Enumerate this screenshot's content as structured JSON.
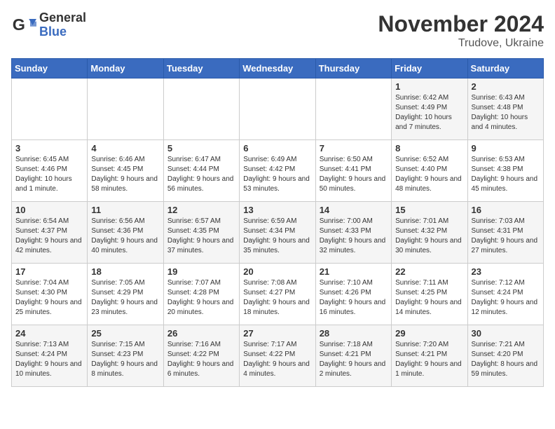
{
  "logo": {
    "general": "General",
    "blue": "Blue"
  },
  "title": "November 2024",
  "location": "Trudove, Ukraine",
  "days_of_week": [
    "Sunday",
    "Monday",
    "Tuesday",
    "Wednesday",
    "Thursday",
    "Friday",
    "Saturday"
  ],
  "weeks": [
    [
      {
        "day": "",
        "info": ""
      },
      {
        "day": "",
        "info": ""
      },
      {
        "day": "",
        "info": ""
      },
      {
        "day": "",
        "info": ""
      },
      {
        "day": "",
        "info": ""
      },
      {
        "day": "1",
        "info": "Sunrise: 6:42 AM\nSunset: 4:49 PM\nDaylight: 10 hours and 7 minutes."
      },
      {
        "day": "2",
        "info": "Sunrise: 6:43 AM\nSunset: 4:48 PM\nDaylight: 10 hours and 4 minutes."
      }
    ],
    [
      {
        "day": "3",
        "info": "Sunrise: 6:45 AM\nSunset: 4:46 PM\nDaylight: 10 hours and 1 minute."
      },
      {
        "day": "4",
        "info": "Sunrise: 6:46 AM\nSunset: 4:45 PM\nDaylight: 9 hours and 58 minutes."
      },
      {
        "day": "5",
        "info": "Sunrise: 6:47 AM\nSunset: 4:44 PM\nDaylight: 9 hours and 56 minutes."
      },
      {
        "day": "6",
        "info": "Sunrise: 6:49 AM\nSunset: 4:42 PM\nDaylight: 9 hours and 53 minutes."
      },
      {
        "day": "7",
        "info": "Sunrise: 6:50 AM\nSunset: 4:41 PM\nDaylight: 9 hours and 50 minutes."
      },
      {
        "day": "8",
        "info": "Sunrise: 6:52 AM\nSunset: 4:40 PM\nDaylight: 9 hours and 48 minutes."
      },
      {
        "day": "9",
        "info": "Sunrise: 6:53 AM\nSunset: 4:38 PM\nDaylight: 9 hours and 45 minutes."
      }
    ],
    [
      {
        "day": "10",
        "info": "Sunrise: 6:54 AM\nSunset: 4:37 PM\nDaylight: 9 hours and 42 minutes."
      },
      {
        "day": "11",
        "info": "Sunrise: 6:56 AM\nSunset: 4:36 PM\nDaylight: 9 hours and 40 minutes."
      },
      {
        "day": "12",
        "info": "Sunrise: 6:57 AM\nSunset: 4:35 PM\nDaylight: 9 hours and 37 minutes."
      },
      {
        "day": "13",
        "info": "Sunrise: 6:59 AM\nSunset: 4:34 PM\nDaylight: 9 hours and 35 minutes."
      },
      {
        "day": "14",
        "info": "Sunrise: 7:00 AM\nSunset: 4:33 PM\nDaylight: 9 hours and 32 minutes."
      },
      {
        "day": "15",
        "info": "Sunrise: 7:01 AM\nSunset: 4:32 PM\nDaylight: 9 hours and 30 minutes."
      },
      {
        "day": "16",
        "info": "Sunrise: 7:03 AM\nSunset: 4:31 PM\nDaylight: 9 hours and 27 minutes."
      }
    ],
    [
      {
        "day": "17",
        "info": "Sunrise: 7:04 AM\nSunset: 4:30 PM\nDaylight: 9 hours and 25 minutes."
      },
      {
        "day": "18",
        "info": "Sunrise: 7:05 AM\nSunset: 4:29 PM\nDaylight: 9 hours and 23 minutes."
      },
      {
        "day": "19",
        "info": "Sunrise: 7:07 AM\nSunset: 4:28 PM\nDaylight: 9 hours and 20 minutes."
      },
      {
        "day": "20",
        "info": "Sunrise: 7:08 AM\nSunset: 4:27 PM\nDaylight: 9 hours and 18 minutes."
      },
      {
        "day": "21",
        "info": "Sunrise: 7:10 AM\nSunset: 4:26 PM\nDaylight: 9 hours and 16 minutes."
      },
      {
        "day": "22",
        "info": "Sunrise: 7:11 AM\nSunset: 4:25 PM\nDaylight: 9 hours and 14 minutes."
      },
      {
        "day": "23",
        "info": "Sunrise: 7:12 AM\nSunset: 4:24 PM\nDaylight: 9 hours and 12 minutes."
      }
    ],
    [
      {
        "day": "24",
        "info": "Sunrise: 7:13 AM\nSunset: 4:24 PM\nDaylight: 9 hours and 10 minutes."
      },
      {
        "day": "25",
        "info": "Sunrise: 7:15 AM\nSunset: 4:23 PM\nDaylight: 9 hours and 8 minutes."
      },
      {
        "day": "26",
        "info": "Sunrise: 7:16 AM\nSunset: 4:22 PM\nDaylight: 9 hours and 6 minutes."
      },
      {
        "day": "27",
        "info": "Sunrise: 7:17 AM\nSunset: 4:22 PM\nDaylight: 9 hours and 4 minutes."
      },
      {
        "day": "28",
        "info": "Sunrise: 7:18 AM\nSunset: 4:21 PM\nDaylight: 9 hours and 2 minutes."
      },
      {
        "day": "29",
        "info": "Sunrise: 7:20 AM\nSunset: 4:21 PM\nDaylight: 9 hours and 1 minute."
      },
      {
        "day": "30",
        "info": "Sunrise: 7:21 AM\nSunset: 4:20 PM\nDaylight: 8 hours and 59 minutes."
      }
    ]
  ]
}
